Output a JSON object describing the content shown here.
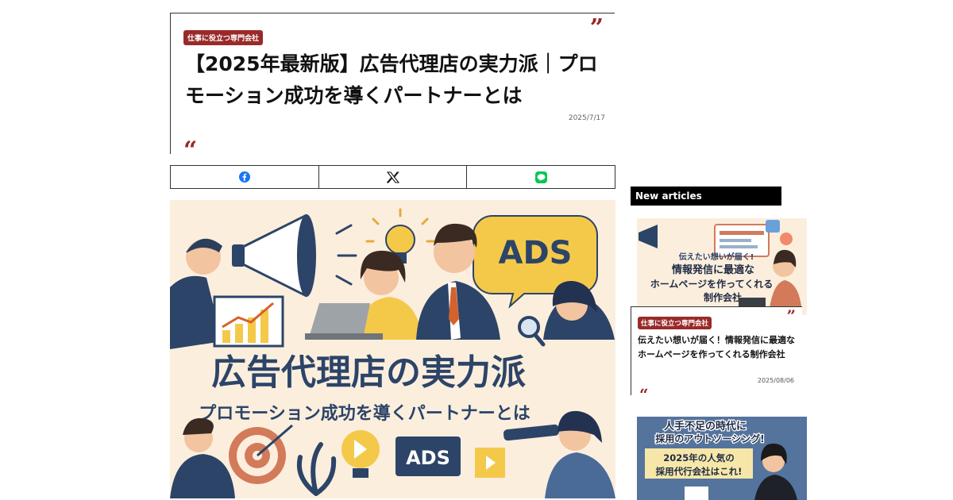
{
  "article": {
    "category": "仕事に役立つ専門会社",
    "title": "【2025年最新版】広告代理店の実力派｜プロモーション成功を導くパートナーとは",
    "date": "2025/7/17"
  },
  "share": [
    {
      "network": "facebook",
      "icon": "facebook-icon",
      "color": "#1877f2"
    },
    {
      "network": "x",
      "icon": "x-icon",
      "color": "#111111"
    },
    {
      "network": "line",
      "icon": "line-icon",
      "color": "#06c755"
    }
  ],
  "hero": {
    "main_text": "広告代理店の実力派",
    "sub_text": "プロモーション成功を導くパートナーとは",
    "bubble_text": "ADS",
    "monitor_text": "ADS"
  },
  "sidebar": {
    "header": "New articles",
    "articles": [
      {
        "thumb_line1": "伝えたい想いが届く!",
        "thumb_line2": "情報発信に最適な",
        "thumb_line3": "ホームページを作ってくれる",
        "thumb_line4": "制作会社",
        "category": "仕事に役立つ専門会社",
        "title": "伝えたい想いが届く！情報発信に最適なホームページを作ってくれる制作会社",
        "date": "2025/08/06"
      },
      {
        "thumb_line1": "人手不足の時代に",
        "thumb_line2": "採用のアウトソーシング!",
        "thumb_line3": "2025年の人気の",
        "thumb_line4": "採用代行会社はこれ!"
      }
    ]
  },
  "colors": {
    "accent": "#9a2a2a",
    "hero_navy": "#2c4468",
    "hero_bg": "#fbeedd",
    "ads_yellow": "#f4c94a"
  }
}
